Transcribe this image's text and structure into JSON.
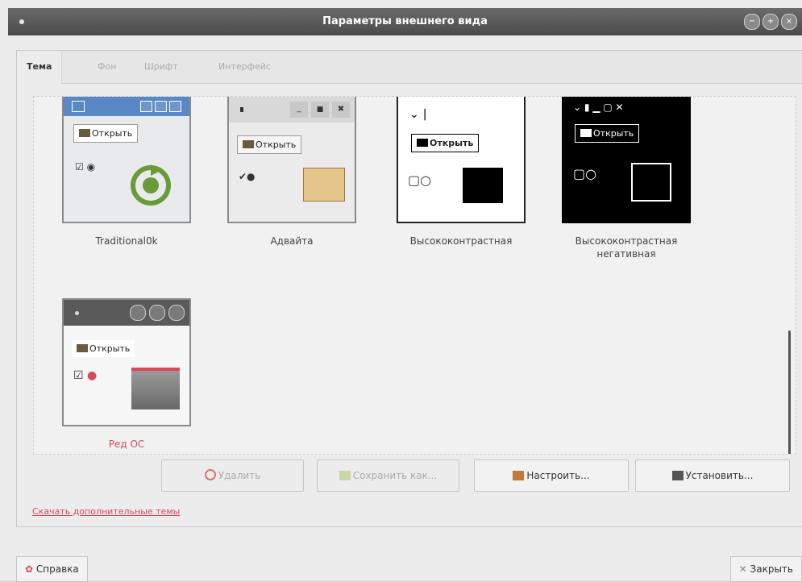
{
  "window": {
    "title": "Параметры внешнего вида",
    "buttons": [
      "−",
      "+",
      "×"
    ]
  },
  "tabs": [
    {
      "label": "Тема",
      "active": true
    },
    {
      "label": "Фон",
      "active": false
    },
    {
      "label": "Шрифт",
      "active": false
    },
    {
      "label": "Интерфейс",
      "active": false
    }
  ],
  "themes": [
    {
      "name": "Traditional0k",
      "open_label": "Открыть"
    },
    {
      "name": "Адвайта",
      "open_label": "Открыть"
    },
    {
      "name": "Высококонтрастная",
      "open_label": "Открыть"
    },
    {
      "name": "Высококонтрастная негативная",
      "open_label": "Открыть"
    },
    {
      "name": "Ред ОС",
      "open_label": "Открыть"
    }
  ],
  "actions": {
    "delete": "Удалить",
    "save_as": "Сохранить как...",
    "configure": "Настроить...",
    "install": "Установить..."
  },
  "download_link": "Скачать дополнительные темы",
  "footer": {
    "help": "Справка",
    "close": "Закрыть"
  },
  "colors": {
    "accent": "#d64a5a",
    "selected_theme_name": "#d64a5a"
  }
}
